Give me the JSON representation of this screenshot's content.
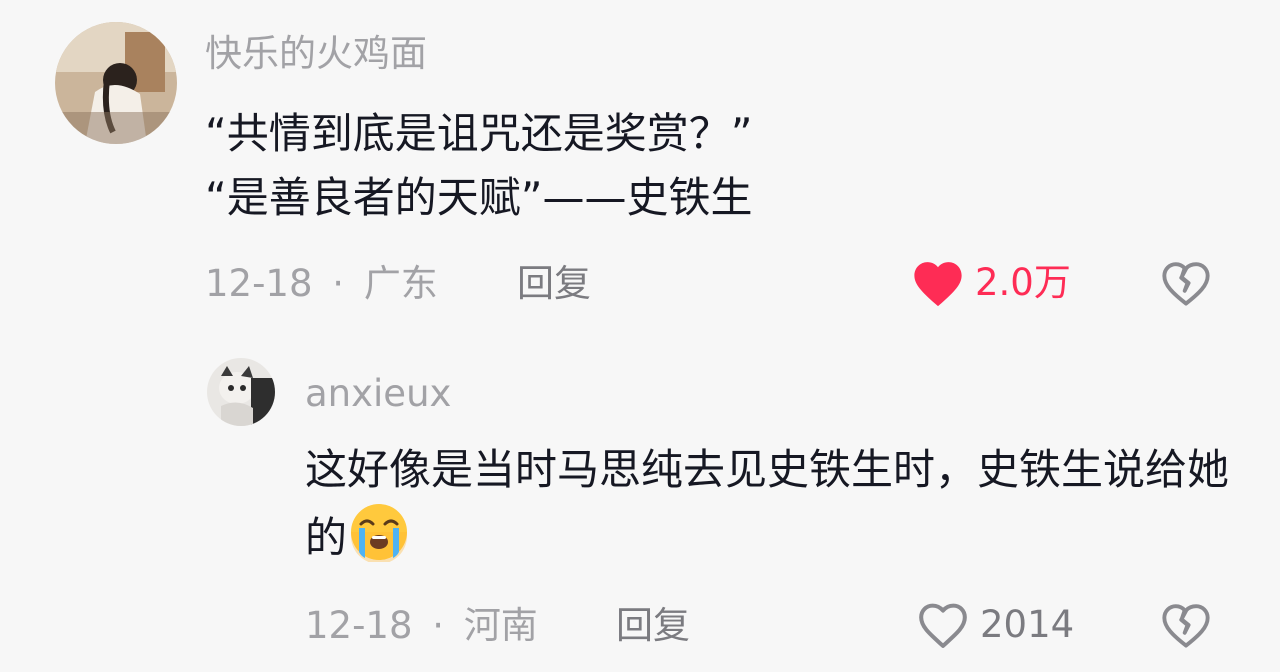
{
  "comment": {
    "username": "快乐的火鸡面",
    "text": "“共情到底是诅咒还是奖赏？”\n“是善良者的天赋”——史铁生",
    "date": "12-18",
    "separator": "·",
    "location": "广东",
    "reply_label": "回复",
    "like_count": "2.0万",
    "liked": true,
    "like_icon": "heart-filled-icon",
    "dislike_icon": "broken-heart-icon",
    "colors": {
      "like_active": "#fe2c55",
      "muted": "#a2a2a6"
    }
  },
  "reply": {
    "username": "anxieux",
    "text": "这好像是当时马思纯去见史铁生时，史铁生说给她的",
    "emoji": "crying-face-emoji",
    "date": "12-18",
    "separator": "·",
    "location": "河南",
    "reply_label": "回复",
    "like_count": "2014",
    "liked": false,
    "like_icon": "heart-outline-icon",
    "dislike_icon": "broken-heart-icon"
  }
}
